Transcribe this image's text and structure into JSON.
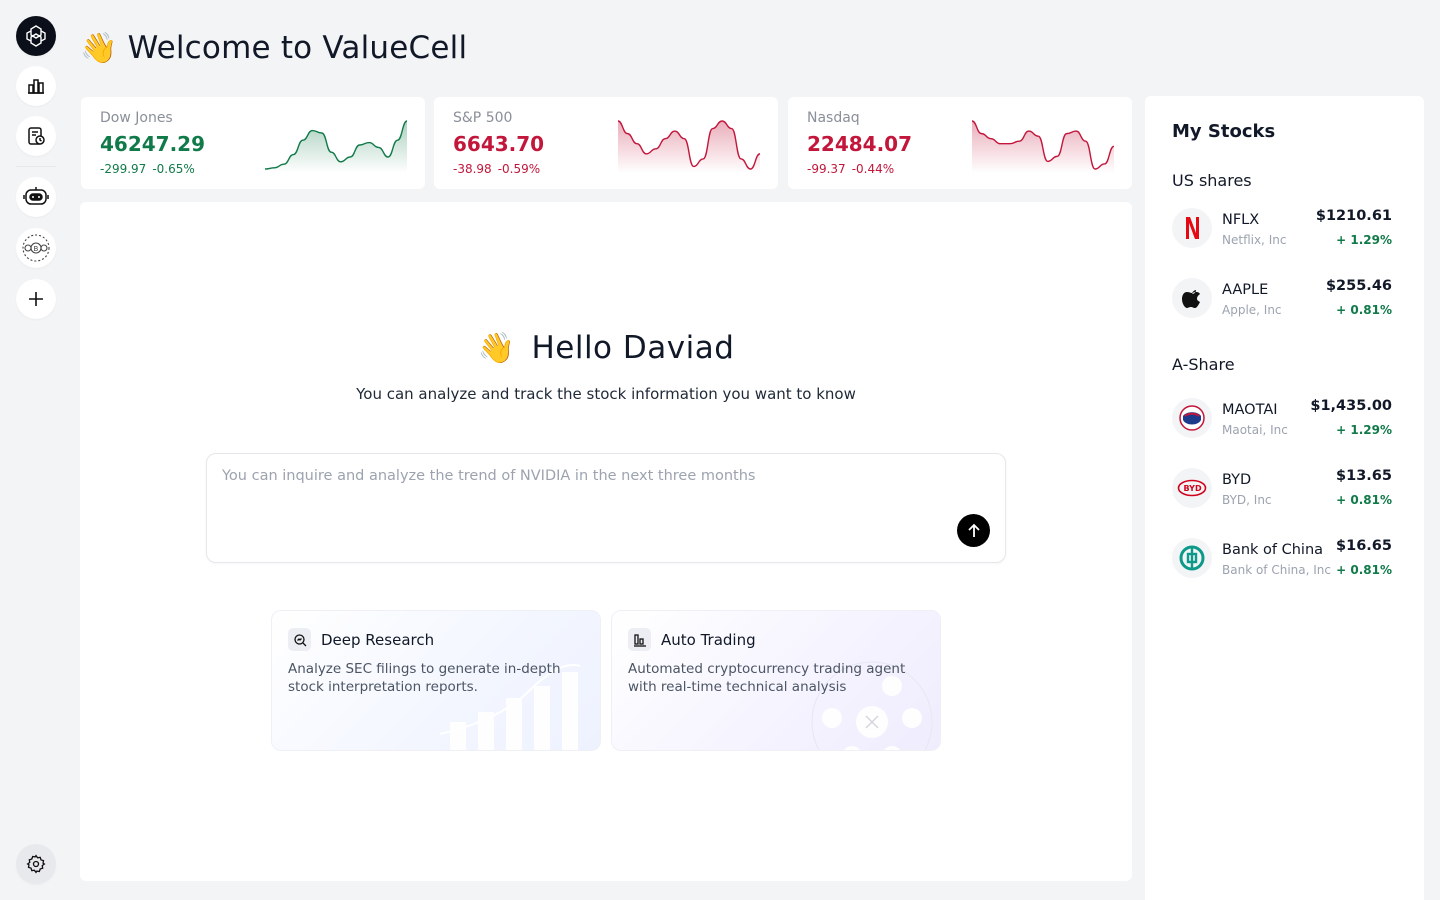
{
  "header": {
    "wave": "👋",
    "title": "Welcome to ValueCell"
  },
  "sidebar": {
    "items": [
      {
        "name": "logo",
        "icon": "valuecell-logo-icon"
      },
      {
        "name": "market",
        "icon": "bar-chart-icon"
      },
      {
        "name": "watchlist",
        "icon": "document-clock-icon"
      },
      {
        "name": "agent-robot",
        "icon": "robot-icon"
      },
      {
        "name": "agent-crypto",
        "icon": "coins-icon"
      },
      {
        "name": "add",
        "icon": "plus-icon"
      },
      {
        "name": "settings",
        "icon": "gear-icon"
      }
    ]
  },
  "indices": [
    {
      "name": "Dow Jones",
      "value": "46247.29",
      "change": "-299.97",
      "pct": "-0.65%",
      "trend": "up",
      "color": "#117a49",
      "spark": [
        8,
        9,
        12,
        20,
        32,
        40,
        38,
        22,
        14,
        18,
        28,
        30,
        26,
        18,
        32,
        48
      ]
    },
    {
      "name": "S&P 500",
      "value": "6643.70",
      "change": "-38.98",
      "pct": "-0.59%",
      "trend": "down",
      "color": "#c2173b",
      "spark": [
        48,
        38,
        30,
        22,
        26,
        34,
        40,
        34,
        12,
        18,
        42,
        48,
        42,
        18,
        10,
        22
      ]
    },
    {
      "name": "Nasdaq",
      "value": "22484.07",
      "change": "-99.37",
      "pct": "-0.44%",
      "trend": "down",
      "color": "#c2173b",
      "spark": [
        48,
        38,
        34,
        30,
        30,
        32,
        40,
        36,
        16,
        20,
        38,
        40,
        32,
        10,
        14,
        28
      ]
    }
  ],
  "main": {
    "wave": "👋",
    "greeting": "Hello Daviad",
    "subtitle": "You can analyze and track the stock information you want to know",
    "placeholder": "You can inquire and analyze the trend of NVIDIA in the next three months",
    "features": [
      {
        "title": "Deep Research",
        "desc": "Analyze SEC filings to generate in-depth stock interpretation reports.",
        "icon": "research-search-icon"
      },
      {
        "title": "Auto Trading",
        "desc": "Automated cryptocurrency trading agent with real-time technical analysis",
        "icon": "trading-bars-icon"
      }
    ]
  },
  "my_stocks": {
    "title": "My Stocks",
    "groups": [
      {
        "title": "US shares",
        "stocks": [
          {
            "symbol": "NFLX",
            "name": "Netflix, Inc",
            "price": "$1210.61",
            "change": "+ 1.29%",
            "logo": "netflix-logo-icon"
          },
          {
            "symbol": "AAPLE",
            "name": "Apple, Inc",
            "price": "$255.46",
            "change": "+ 0.81%",
            "logo": "apple-logo-icon"
          }
        ]
      },
      {
        "title": "A-Share",
        "stocks": [
          {
            "symbol": "MAOTAI",
            "name": "Maotai, Inc",
            "price": "$1,435.00",
            "change": "+ 1.29%",
            "logo": "maotai-logo-icon"
          },
          {
            "symbol": "BYD",
            "name": "BYD, Inc",
            "price": "$13.65",
            "change": "+ 0.81%",
            "logo": "byd-logo-icon"
          },
          {
            "symbol": "Bank of China",
            "name": "Bank of China, Inc",
            "price": "$16.65",
            "change": "+ 0.81%",
            "logo": "bank-of-china-logo-icon"
          }
        ]
      }
    ]
  },
  "colors": {
    "up": "#117a49",
    "down": "#c2173b",
    "accent": "#000000"
  }
}
